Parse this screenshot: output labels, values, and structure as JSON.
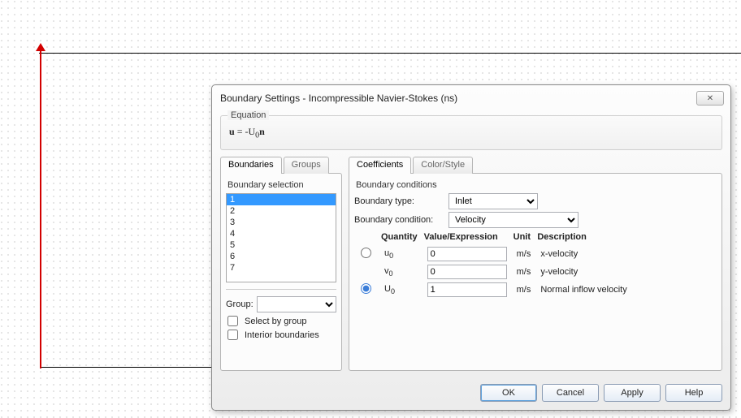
{
  "dialog": {
    "title": "Boundary Settings - Incompressible Navier-Stokes (ns)",
    "close_glyph": "✕"
  },
  "equation": {
    "legend": "Equation",
    "text_html": "u = -U₀n"
  },
  "left": {
    "tabs": {
      "boundaries": "Boundaries",
      "groups": "Groups"
    },
    "selection_label": "Boundary selection",
    "items": [
      "1",
      "2",
      "3",
      "4",
      "5",
      "6",
      "7"
    ],
    "selected_index": 0,
    "group_label": "Group:",
    "group_value": "",
    "select_by_group": "Select by group",
    "interior_boundaries": "Interior boundaries"
  },
  "right": {
    "tabs": {
      "coefficients": "Coefficients",
      "colorstyle": "Color/Style"
    },
    "bc_legend": "Boundary conditions",
    "type_label": "Boundary type:",
    "type_value": "Inlet",
    "cond_label": "Boundary condition:",
    "cond_value": "Velocity",
    "headers": {
      "quantity": "Quantity",
      "value": "Value/Expression",
      "unit": "Unit",
      "description": "Description"
    },
    "rows": [
      {
        "sym": "u",
        "sub": "0",
        "value": "0",
        "unit": "m/s",
        "desc": "x-velocity"
      },
      {
        "sym": "v",
        "sub": "0",
        "value": "0",
        "unit": "m/s",
        "desc": "y-velocity"
      },
      {
        "sym": "U",
        "sub": "0",
        "value": "1",
        "unit": "m/s",
        "desc": "Normal inflow velocity"
      }
    ],
    "radio_selected": 2
  },
  "buttons": {
    "ok": "OK",
    "cancel": "Cancel",
    "apply": "Apply",
    "help": "Help"
  }
}
